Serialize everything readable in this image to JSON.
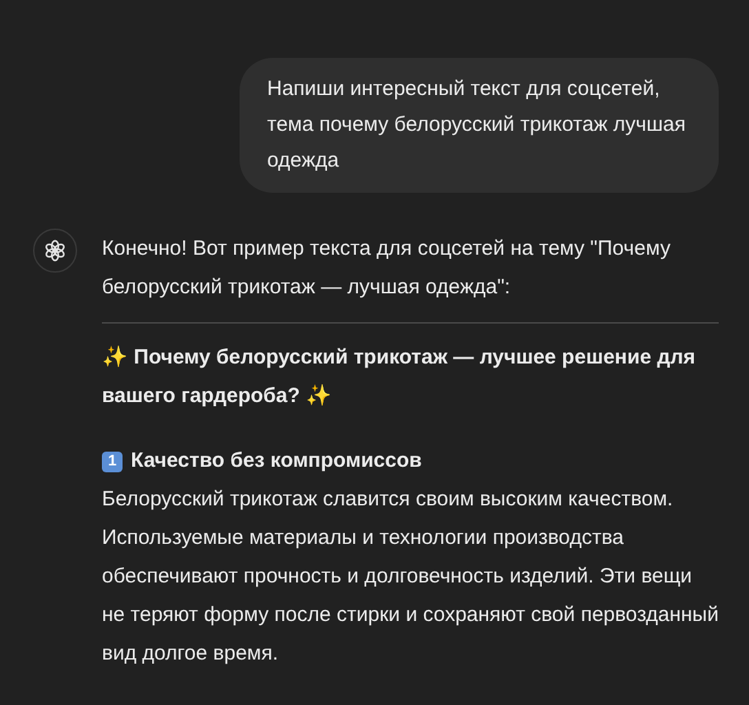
{
  "user_message": {
    "text": "Напиши интересный текст для соцсетей, тема почему белорусский трикотаж лучшая одежда"
  },
  "assistant_message": {
    "intro": "Конечно! Вот пример текста для соцсетей на тему \"Почему белорусский трикотаж — лучшая одежда\":",
    "heading": "✨ Почему белорусский трикотаж — лучшее решение для вашего гардероба? ✨",
    "sections": [
      {
        "number": "1",
        "title": "Качество без компромиссов",
        "body": "Белорусский трикотаж славится своим высоким качеством. Используемые материалы и технологии производства обеспечивают прочность и долговечность изделий. Эти вещи не теряют форму после стирки и сохраняют свой первозданный вид долгое время."
      }
    ]
  }
}
